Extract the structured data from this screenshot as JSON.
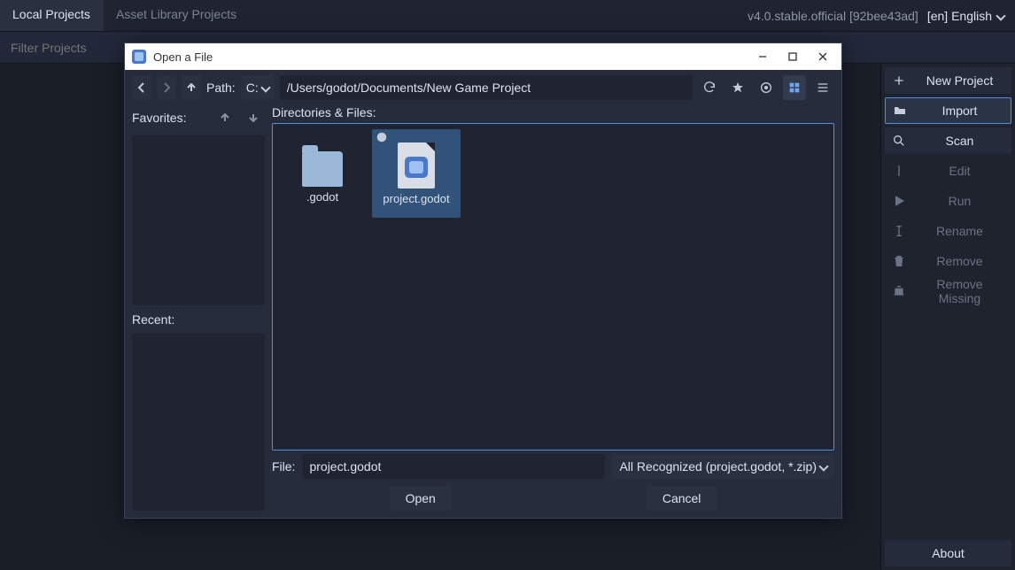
{
  "topbar": {
    "tabs": [
      "Local Projects",
      "Asset Library Projects"
    ],
    "version": "v4.0.stable.official [92bee43ad]",
    "language": "[en] English"
  },
  "filterbar": {
    "placeholder": "Filter Projects"
  },
  "sidebar": {
    "new_project": "New Project",
    "import": "Import",
    "scan": "Scan",
    "edit": "Edit",
    "run": "Run",
    "rename": "Rename",
    "remove": "Remove",
    "remove_missing": "Remove Missing",
    "about": "About"
  },
  "dialog": {
    "title": "Open a File",
    "path_label": "Path:",
    "drive": "C:",
    "path_value": "/Users/godot/Documents/New Game Project",
    "favorites_label": "Favorites:",
    "recent_label": "Recent:",
    "dirs_label": "Directories & Files:",
    "files": [
      {
        "name": ".godot",
        "type": "folder",
        "selected": false
      },
      {
        "name": "project.godot",
        "type": "project",
        "selected": true
      }
    ],
    "file_label": "File:",
    "file_value": "project.godot",
    "filter": "All Recognized (project.godot, *.zip)",
    "open": "Open",
    "cancel": "Cancel"
  }
}
